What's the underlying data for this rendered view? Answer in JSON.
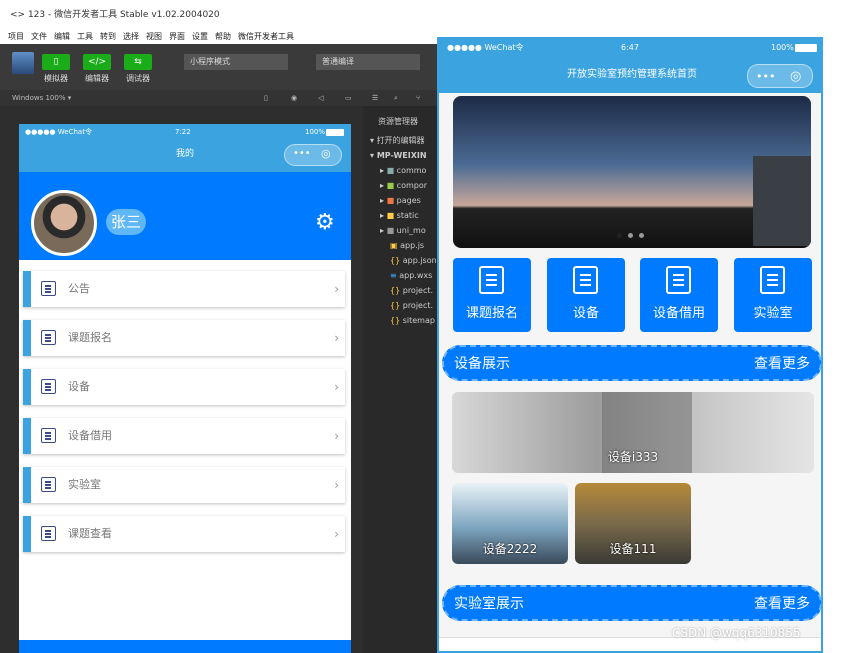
{
  "window": {
    "title": "<> 123 - 微信开发者工具 Stable v1.02.2004020"
  },
  "menu": [
    "项目",
    "文件",
    "编辑",
    "工具",
    "转到",
    "选择",
    "视图",
    "界面",
    "设置",
    "帮助",
    "微信开发者工具"
  ],
  "toolbar": {
    "simulator": "模拟器",
    "editor": "编辑器",
    "debugger": "调试器",
    "mode": "小程序模式",
    "compile": "普通编译"
  },
  "subbar": {
    "zoom": "Windows 100% ▾"
  },
  "explorer": {
    "title": "资源管理器",
    "open_editors": "打开的编辑器",
    "project": "MP-WEIXIN",
    "items": [
      "commo",
      "compor",
      "pages",
      "static",
      "uni_mo",
      "app.js",
      "app.json",
      "app.wxs",
      "project.",
      "project.",
      "sitemap"
    ]
  },
  "phone1": {
    "status": {
      "carrier": "●●●●● WeChat令",
      "time": "7:22",
      "battery": "100%"
    },
    "nav_title": "我的",
    "username": "张三",
    "items": [
      "公告",
      "课题报名",
      "设备",
      "设备借用",
      "实验室",
      "课题查看"
    ]
  },
  "phone2": {
    "status": {
      "carrier": "●●●●● WeChat令",
      "time": "6:47",
      "battery": "100%"
    },
    "nav_title": "开放实验室预约管理系统首页",
    "grid": [
      "课题报名",
      "设备",
      "设备借用",
      "实验室"
    ],
    "section_devices": {
      "title": "设备展示",
      "more": "查看更多"
    },
    "devices": [
      "设备i333",
      "设备2222",
      "设备111"
    ],
    "section_labs": {
      "title": "实验室展示",
      "more": "查看更多"
    }
  },
  "watermark": "CSDN @wqq6310855",
  "colors": {
    "primary": "#007bff",
    "nav": "#3aa3e0",
    "wechat_green": "#1aad19"
  }
}
